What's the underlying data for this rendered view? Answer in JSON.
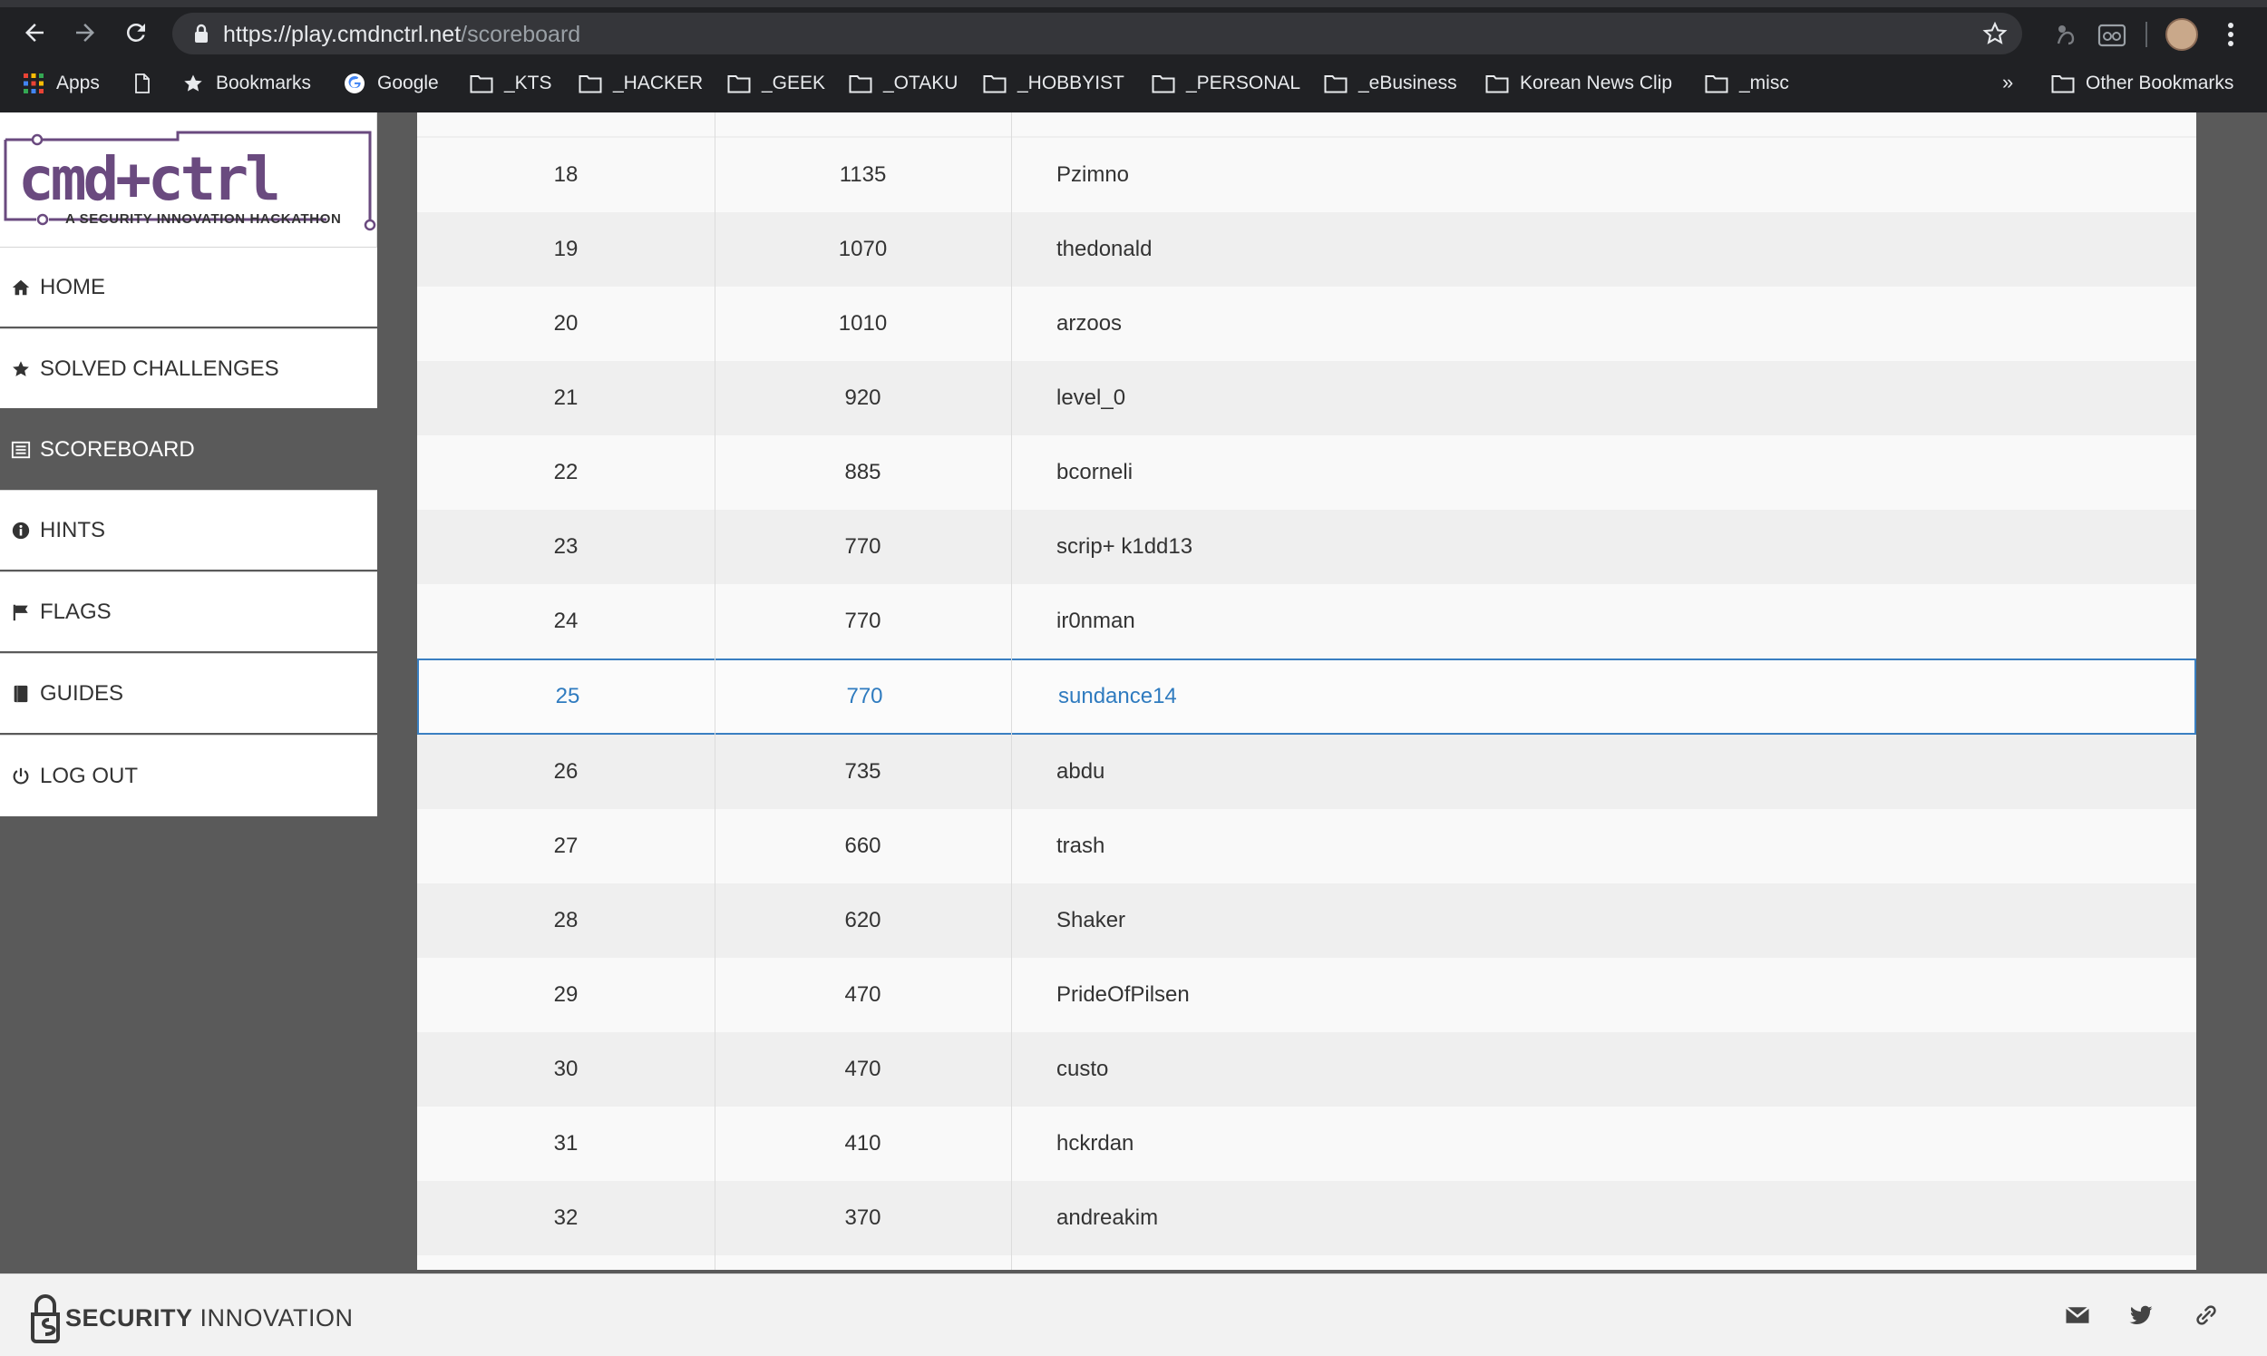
{
  "browser": {
    "url_host": "https://play.cmdnctrl.net",
    "url_path": "/scoreboard",
    "bookmarks": [
      {
        "label": "Apps",
        "icon": "apps-grid-icon"
      },
      {
        "label": "",
        "icon": "page-icon"
      },
      {
        "label": "Bookmarks",
        "icon": "star-icon"
      },
      {
        "label": "Google",
        "icon": "google-icon"
      },
      {
        "label": "_KTS",
        "icon": "folder-icon"
      },
      {
        "label": "_HACKER",
        "icon": "folder-icon"
      },
      {
        "label": "_GEEK",
        "icon": "folder-icon"
      },
      {
        "label": "_OTAKU",
        "icon": "folder-icon"
      },
      {
        "label": "_HOBBYIST",
        "icon": "folder-icon"
      },
      {
        "label": "_PERSONAL",
        "icon": "folder-icon"
      },
      {
        "label": "_eBusiness",
        "icon": "folder-icon"
      },
      {
        "label": "Korean News Clip",
        "icon": "folder-icon"
      },
      {
        "label": "_misc",
        "icon": "folder-icon"
      }
    ],
    "more": "»",
    "other_bookmarks": "Other Bookmarks"
  },
  "logo": {
    "wordmark": "cmd+ctrl",
    "tagline": "A SECURITY INNOVATION HACKATHON"
  },
  "sidebar": {
    "items": [
      {
        "label": "HOME",
        "icon": "home-icon"
      },
      {
        "label": "SOLVED CHALLENGES",
        "icon": "star-icon"
      },
      {
        "label": "SCOREBOARD",
        "icon": "list-icon",
        "active": true
      },
      {
        "label": "HINTS",
        "icon": "info-icon"
      },
      {
        "label": "FLAGS",
        "icon": "flag-icon"
      },
      {
        "label": "GUIDES",
        "icon": "book-icon"
      },
      {
        "label": "LOG OUT",
        "icon": "power-icon"
      }
    ]
  },
  "scoreboard": {
    "highlight_color": "#2f7bbf",
    "rows": [
      {
        "rank": "18",
        "score": "1135",
        "name": "Pzimno"
      },
      {
        "rank": "19",
        "score": "1070",
        "name": "thedonald"
      },
      {
        "rank": "20",
        "score": "1010",
        "name": "arzoos"
      },
      {
        "rank": "21",
        "score": "920",
        "name": "level_0"
      },
      {
        "rank": "22",
        "score": "885",
        "name": "bcorneli"
      },
      {
        "rank": "23",
        "score": "770",
        "name": "scrip+ k1dd13"
      },
      {
        "rank": "24",
        "score": "770",
        "name": "ir0nman"
      },
      {
        "rank": "25",
        "score": "770",
        "name": "sundance14",
        "current_user": true
      },
      {
        "rank": "26",
        "score": "735",
        "name": "abdu"
      },
      {
        "rank": "27",
        "score": "660",
        "name": "trash"
      },
      {
        "rank": "28",
        "score": "620",
        "name": "Shaker"
      },
      {
        "rank": "29",
        "score": "470",
        "name": "PrideOfPilsen"
      },
      {
        "rank": "30",
        "score": "470",
        "name": "custo"
      },
      {
        "rank": "31",
        "score": "410",
        "name": "hckrdan"
      },
      {
        "rank": "32",
        "score": "370",
        "name": "andreakim"
      }
    ]
  },
  "footer": {
    "brand_bold": "SECURITY",
    "brand_light": "INNOVATION",
    "icons": [
      "mail-icon",
      "twitter-icon",
      "link-icon"
    ]
  }
}
